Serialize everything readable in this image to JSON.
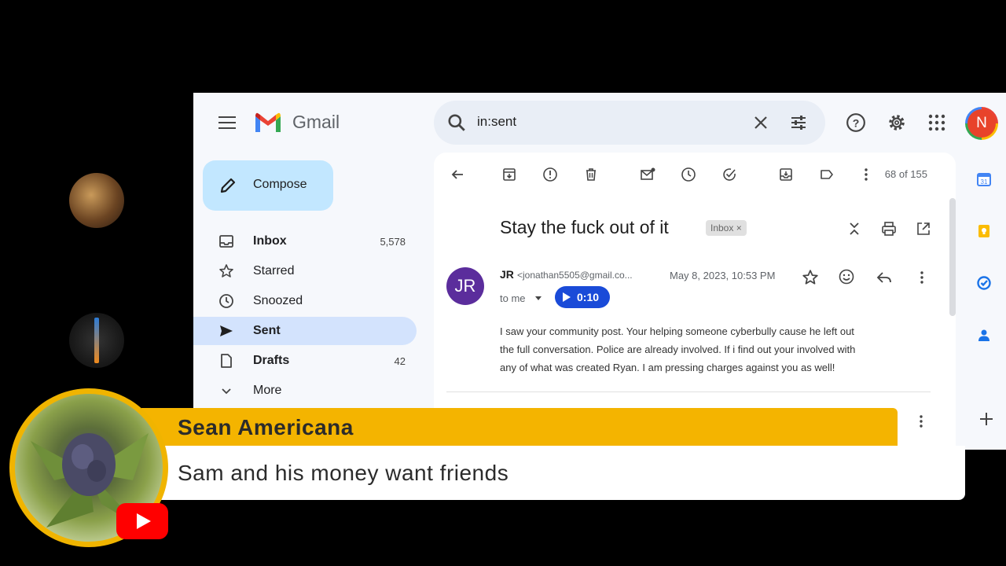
{
  "gmail": {
    "app_name": "Gmail",
    "search": {
      "value": "in:sent"
    },
    "account_initial": "N",
    "compose_label": "Compose",
    "nav": [
      {
        "label": "Inbox",
        "count": "5,578"
      },
      {
        "label": "Starred",
        "count": ""
      },
      {
        "label": "Snoozed",
        "count": ""
      },
      {
        "label": "Sent",
        "count": ""
      },
      {
        "label": "Drafts",
        "count": "42"
      },
      {
        "label": "More",
        "count": ""
      }
    ],
    "message_counter": "68 of 155",
    "subject": "Stay the fuck out of it",
    "label_chip": "Inbox ×",
    "sender": {
      "initials": "JR",
      "name": "JR",
      "email": "<jonathan5505@gmail.co...",
      "date": "May 8, 2023, 10:53 PM",
      "to": "to me"
    },
    "audio_duration": "0:10",
    "body_lines": [
      "I saw your community post.  Your helping someone cyberbully cause he left out",
      "the full conversation.  Police are already involved.  If i find out your involved with",
      "any of what was created Ryan.  I am pressing charges against you as well!"
    ]
  },
  "overlay": {
    "name": "Sean Americana",
    "message": "Sam and his money want friends"
  },
  "colors": {
    "banner_yellow": "#f4b400",
    "compose_bg": "#c2e7ff",
    "sent_active": "#d3e3fd",
    "audio_pill": "#1a4bd8",
    "sender_avatar": "#5b2d9c"
  }
}
